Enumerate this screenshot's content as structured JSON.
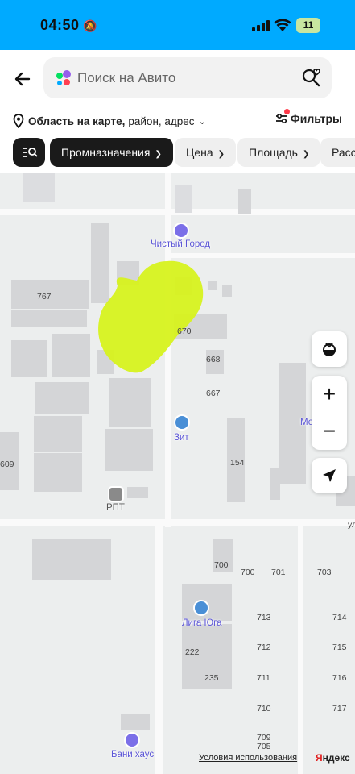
{
  "status_bar": {
    "time": "04:50",
    "battery": "11",
    "bg_color": "#00aaff"
  },
  "search": {
    "placeholder": "Поиск на Авито"
  },
  "location": {
    "bold": "Область на карте,",
    "rest": "район, адрес"
  },
  "filters_label": "Фильтры",
  "chips": [
    {
      "label": "Промназначения",
      "active": true
    },
    {
      "label": "Цена",
      "active": false
    },
    {
      "label": "Площадь",
      "active": false
    },
    {
      "label": "Расс",
      "active": false
    }
  ],
  "map": {
    "pois": [
      {
        "label": "Чистый Город",
        "icon": "map-pin-icon"
      },
      {
        "label": "Зит",
        "icon": "car-icon"
      },
      {
        "label": "РПТ",
        "icon": "building-icon"
      },
      {
        "label": "Лига Юга",
        "icon": "shopping-bag-icon"
      },
      {
        "label": "Бани хаус",
        "icon": "map-pin-icon"
      }
    ],
    "house_numbers": [
      "767",
      "670",
      "668",
      "667",
      "154",
      "609",
      "700",
      "700",
      "701",
      "703",
      "713",
      "714",
      "712",
      "715",
      "222",
      "235",
      "711",
      "716",
      "710",
      "717",
      "709",
      "705"
    ],
    "street_fragment": "ул",
    "metro_fragment": "Ме",
    "highlight_color": "#d7f21e"
  },
  "controls": {
    "zoom_in": "+",
    "zoom_out": "−"
  },
  "footer": {
    "terms": "Условия использования",
    "yandex_first": "Я",
    "yandex_rest": "ндекс"
  }
}
